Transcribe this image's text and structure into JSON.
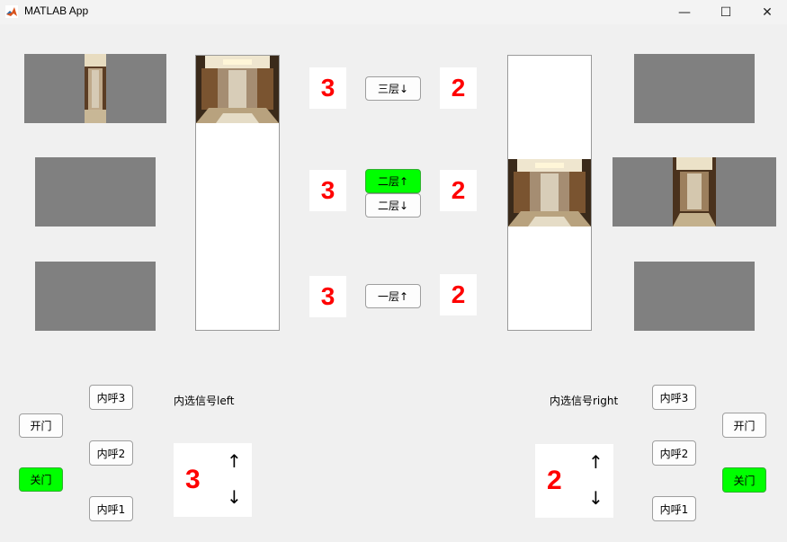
{
  "window": {
    "title": "MATLAB App",
    "min_glyph": "—",
    "max_glyph": "☐",
    "close_glyph": "✕"
  },
  "left_displays": [
    "3",
    "3",
    "3"
  ],
  "right_displays": [
    "2",
    "2",
    "2"
  ],
  "hall_buttons": {
    "floor3_down": "三层↓",
    "floor2_up": "二层↑",
    "floor2_down": "二层↓",
    "floor1_up": "一层↑"
  },
  "left_panel": {
    "label": "内选信号left",
    "floor_display": "3",
    "up_arrow": "↑",
    "down_arrow": "↓",
    "open": "开门",
    "close": "关门",
    "call3": "内呼3",
    "call2": "内呼2",
    "call1": "内呼1"
  },
  "right_panel": {
    "label": "内选信号right",
    "floor_display": "2",
    "up_arrow": "↑",
    "down_arrow": "↓",
    "open": "开门",
    "close": "关门",
    "call3": "内呼3",
    "call2": "内呼2",
    "call1": "内呼1"
  },
  "colors": {
    "active": "#00ff00",
    "display_text": "#ff0000",
    "panel_gray": "#808080"
  },
  "icons": {
    "app": "matlab-icon",
    "car": "elevator-car-icon"
  }
}
